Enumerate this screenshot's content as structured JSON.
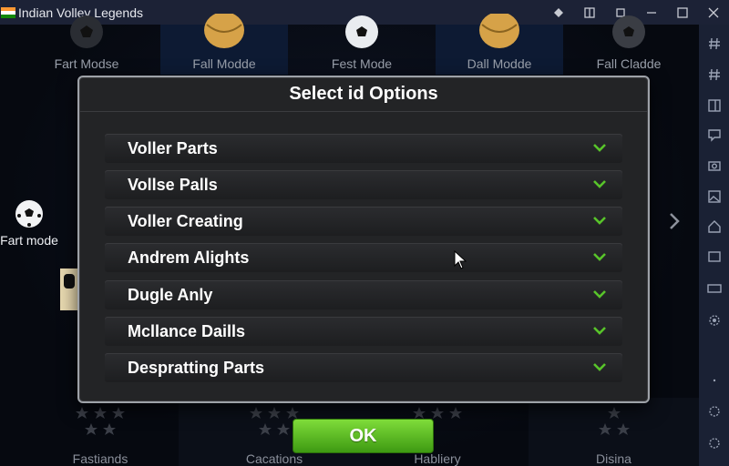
{
  "window": {
    "title": "Indian Volley Legends",
    "controls": [
      "diamond-icon",
      "fit-icon",
      "restore-icon",
      "close-icon",
      "maximize-icon",
      "close-icon"
    ]
  },
  "mode_tabs": [
    {
      "label": "Fart Modse"
    },
    {
      "label": "Fall Modde"
    },
    {
      "label": "Fest Mode"
    },
    {
      "label": "Dall Modde"
    },
    {
      "label": "Fall Cladde"
    }
  ],
  "side_mode": {
    "label": "Fart mode"
  },
  "dialog": {
    "title": "Select id Options",
    "options": [
      {
        "label": "Voller Parts"
      },
      {
        "label": "Vollse Palls"
      },
      {
        "label": "Voller Creating"
      },
      {
        "label": "Andrem Alights"
      },
      {
        "label": "Dugle Anly"
      },
      {
        "label": "Mcllance Daills"
      },
      {
        "label": "Despratting Parts"
      }
    ],
    "ok_label": "OK"
  },
  "bottom_tabs": [
    {
      "label": "Fastiands"
    },
    {
      "label": "Cacations"
    },
    {
      "label": "Habliery"
    },
    {
      "label": "Disina"
    }
  ],
  "colors": {
    "accent_green": "#5bc41f",
    "check_green": "#58c42a",
    "titlebar": "#1c2236"
  }
}
